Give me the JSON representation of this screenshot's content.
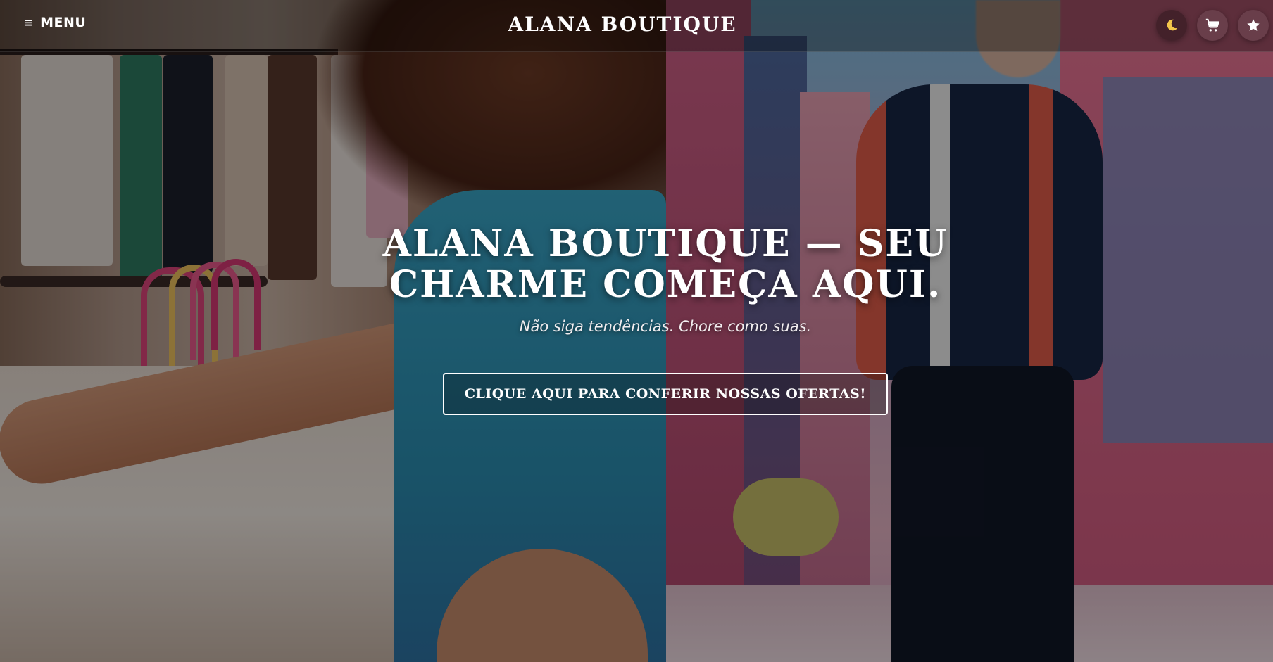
{
  "header": {
    "menu_icon": "≡",
    "menu_label": "MENU",
    "brand": "ALANA BOUTIQUE",
    "icons": [
      "moon-icon",
      "cart-icon",
      "star-icon"
    ]
  },
  "hero": {
    "title_line1": "ALANA BOUTIQUE — SEU",
    "title_line2": "CHARME COMEÇA AQUI.",
    "subtitle": "Não siga tendências. Chore como suas.",
    "cta_label": "CLIQUE AQUI PARA CONFERIR NOSSAS OFERTAS!"
  },
  "colors": {
    "text": "#ffffff",
    "moon": "#f3c64b",
    "overlay": "rgba(0,0,0,0.42)"
  }
}
